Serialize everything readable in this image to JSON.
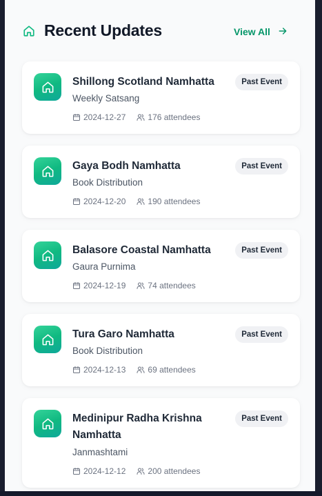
{
  "header": {
    "title": "Recent Updates",
    "view_all_label": "View All",
    "icon": "home-icon",
    "accent_color": "#10b981"
  },
  "updates": [
    {
      "title": "Shillong Scotland Namhatta",
      "subtitle": "Weekly Satsang",
      "date": "2024-12-27",
      "attendees": "176 attendees",
      "badge": "Past Event"
    },
    {
      "title": "Gaya Bodh Namhatta",
      "subtitle": "Book Distribution",
      "date": "2024-12-20",
      "attendees": "190 attendees",
      "badge": "Past Event"
    },
    {
      "title": "Balasore Coastal Namhatta",
      "subtitle": "Gaura Purnima",
      "date": "2024-12-19",
      "attendees": "74 attendees",
      "badge": "Past Event"
    },
    {
      "title": "Tura Garo Namhatta",
      "subtitle": "Book Distribution",
      "date": "2024-12-13",
      "attendees": "69 attendees",
      "badge": "Past Event"
    },
    {
      "title": "Medinipur Radha Krishna Namhatta",
      "subtitle": "Janmashtami",
      "date": "2024-12-12",
      "attendees": "200 attendees",
      "badge": "Past Event"
    }
  ]
}
